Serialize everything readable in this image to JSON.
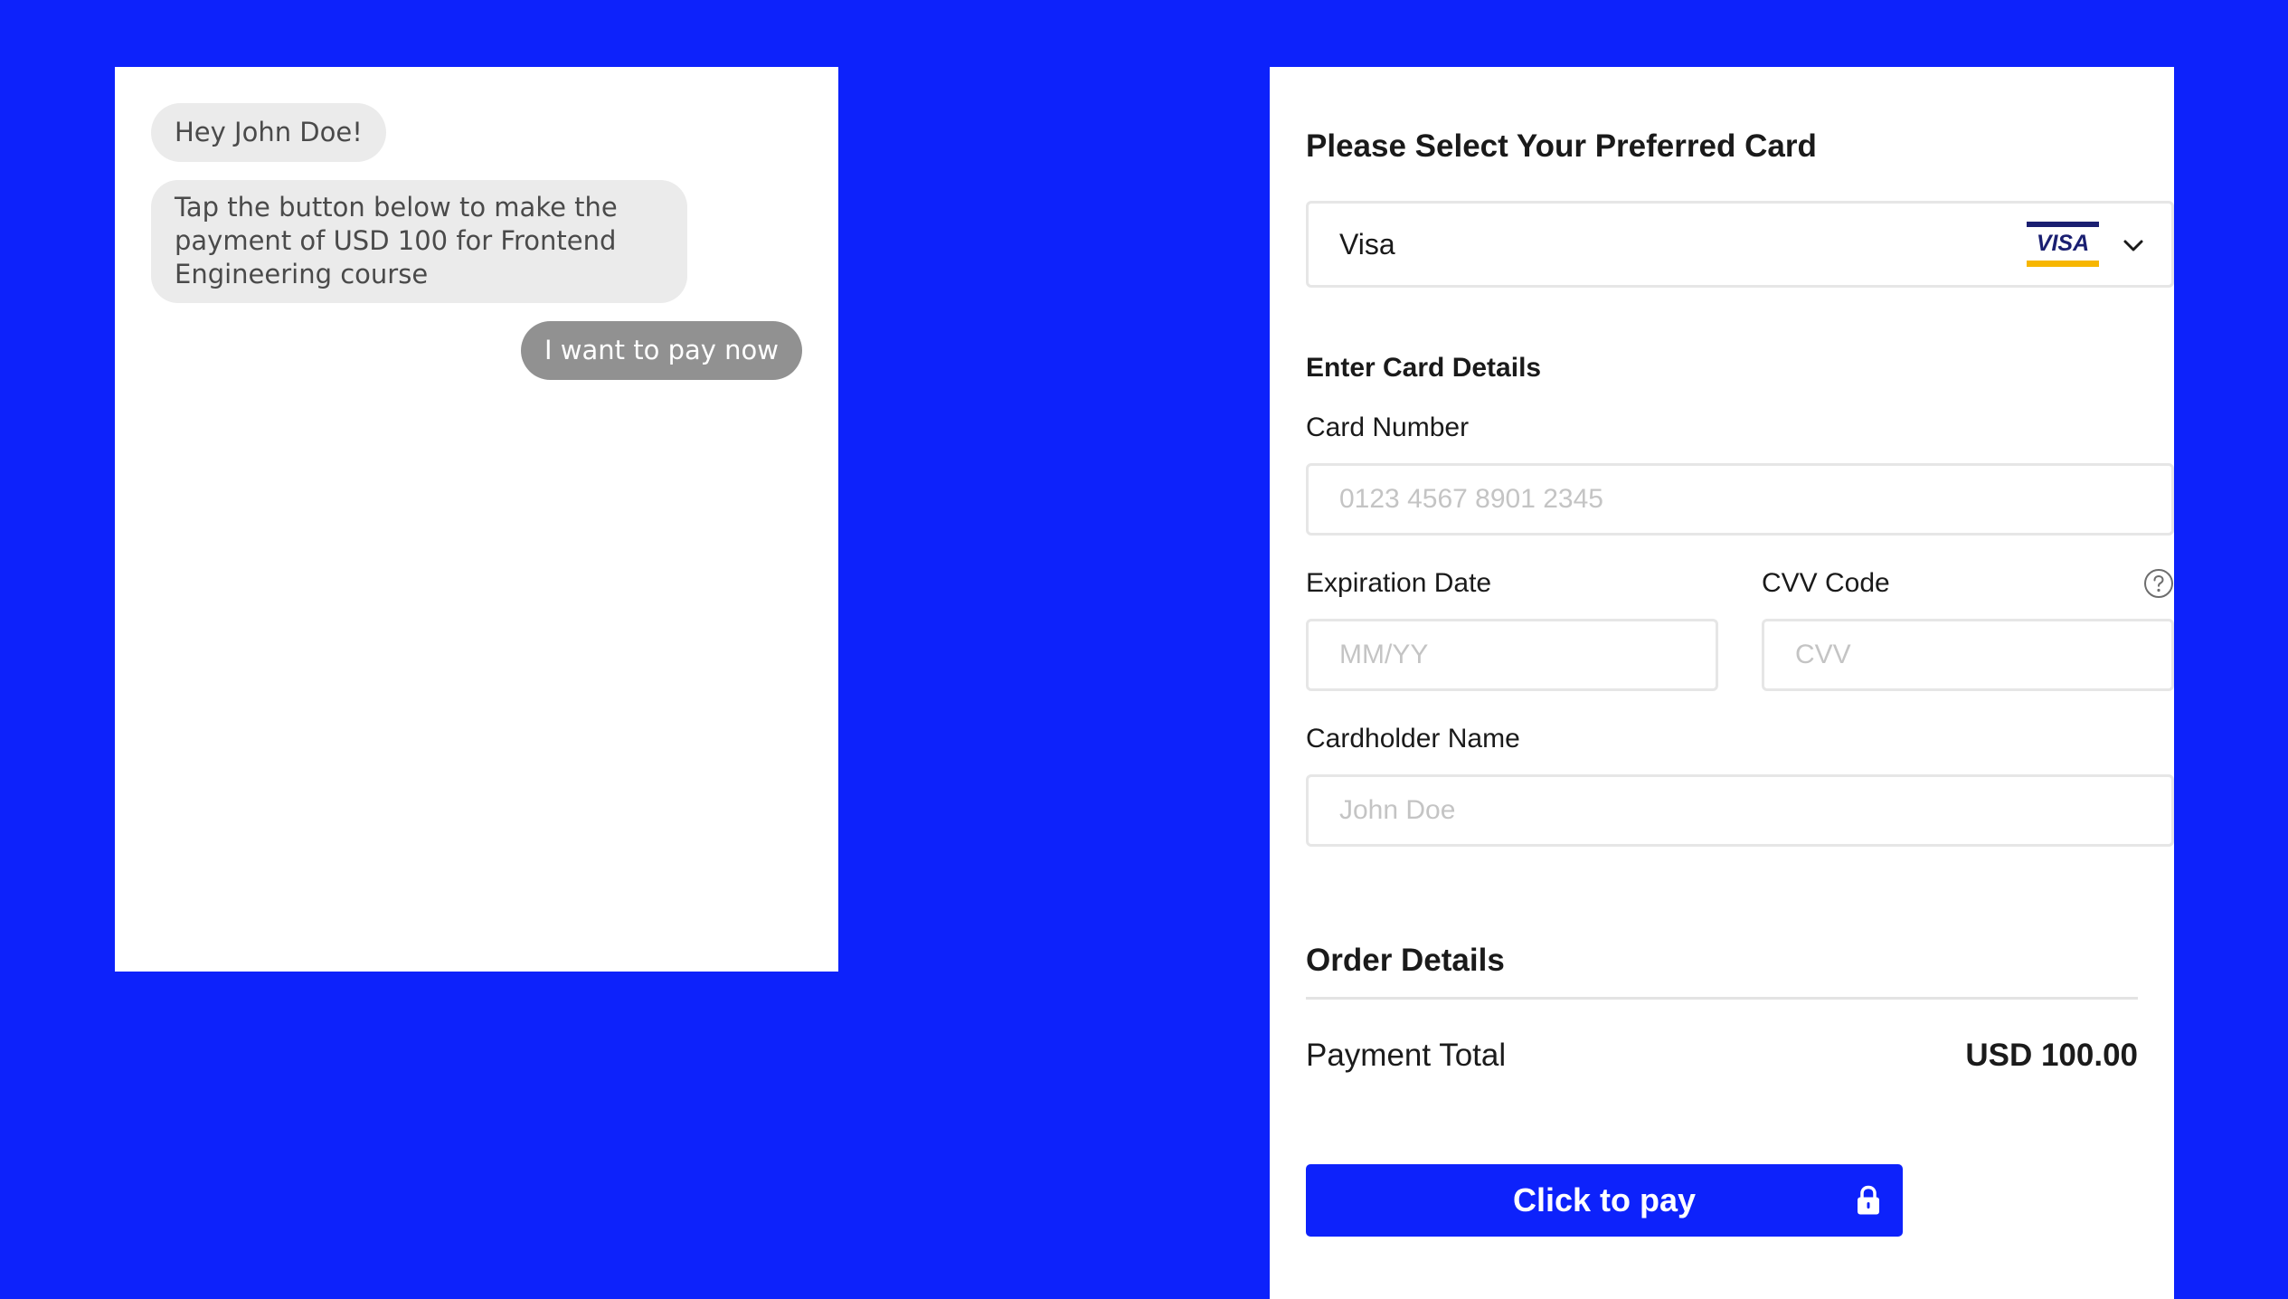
{
  "chat": {
    "messages": [
      {
        "sender": "bot",
        "text": "Hey John Doe!"
      },
      {
        "sender": "bot",
        "text": "Tap the button below to make the payment of USD 100 for Frontend Engineering course"
      },
      {
        "sender": "user",
        "text": "I want to pay now"
      }
    ]
  },
  "payment": {
    "title": "Please Select Your Preferred Card",
    "card_select": {
      "value": "Visa",
      "logo_text": "VISA",
      "icon": "chevron-down-icon"
    },
    "card_details_heading": "Enter Card Details",
    "card_number": {
      "label": "Card Number",
      "placeholder": "0123 4567 8901 2345"
    },
    "expiration": {
      "label": "Expiration Date",
      "placeholder": "MM/YY"
    },
    "cvv": {
      "label": "CVV Code",
      "placeholder": "CVV",
      "icon": "help-icon"
    },
    "cardholder": {
      "label": "Cardholder Name",
      "placeholder": "John Doe"
    },
    "order": {
      "heading": "Order Details",
      "total_label": "Payment Total",
      "total_amount": "USD 100.00"
    },
    "pay_button": {
      "label": "Click to pay",
      "icon": "lock-icon"
    }
  },
  "colors": {
    "background": "#0d22fb",
    "button": "#0d22fb",
    "bot_bubble": "#ebebeb",
    "user_bubble": "#919191",
    "visa_blue": "#1a1f71",
    "visa_gold": "#f7b600"
  }
}
